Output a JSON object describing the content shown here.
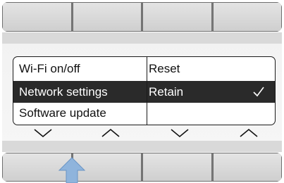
{
  "menu": {
    "left_items": [
      {
        "label": "Wi-Fi on/off",
        "selected": false
      },
      {
        "label": "Network settings",
        "selected": true
      },
      {
        "label": "Software update",
        "selected": false
      }
    ],
    "right_items": [
      {
        "label": "Reset",
        "selected": false
      },
      {
        "label": "Retain",
        "selected": true,
        "checked": true
      },
      {
        "label": "",
        "selected": false
      }
    ]
  },
  "arrows": [
    "chevron-down-icon",
    "chevron-up-icon",
    "chevron-down-icon",
    "chevron-up-icon"
  ],
  "colors": {
    "selection": "#2a2a2a",
    "pointer": "#8fb4dc"
  }
}
